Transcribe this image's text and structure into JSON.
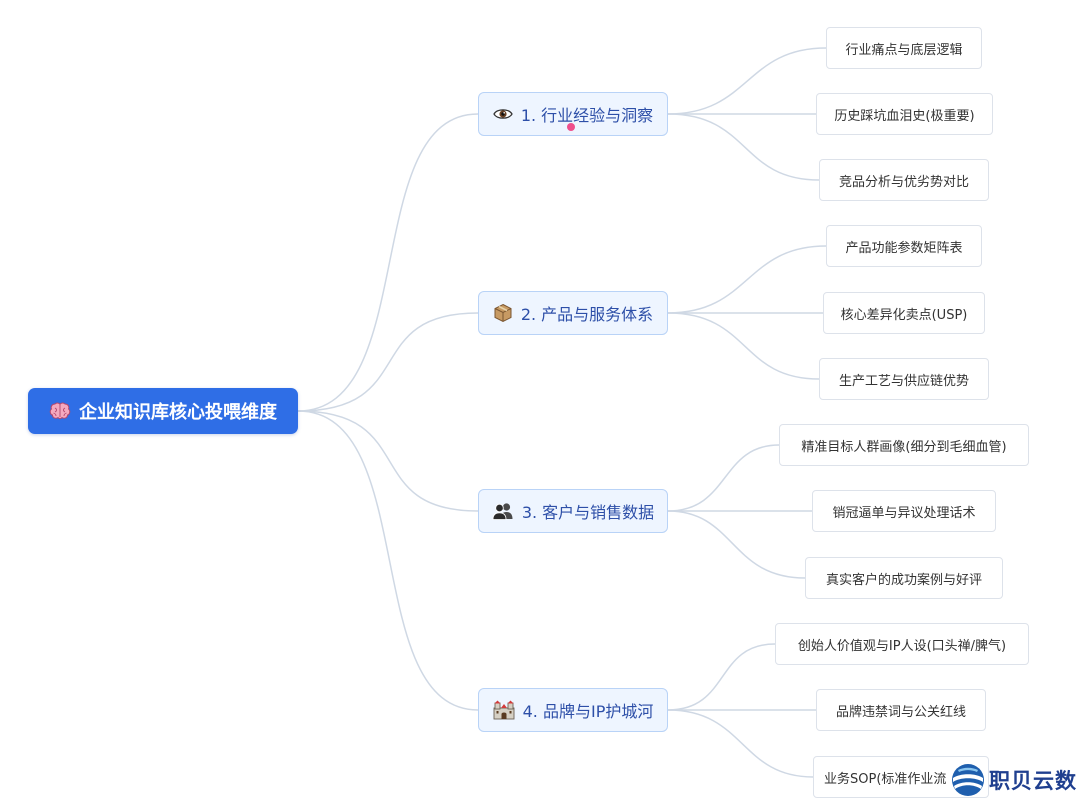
{
  "mindmap": {
    "root": {
      "icon": "brain-icon",
      "label": "企业知识库核心投喂维度"
    },
    "branches": [
      {
        "icon": "eye-icon",
        "label": "1. 行业经验与洞察",
        "children": [
          "行业痛点与底层逻辑",
          "历史踩坑血泪史(极重要)",
          "竞品分析与优劣势对比"
        ]
      },
      {
        "icon": "package-icon",
        "label": "2. 产品与服务体系",
        "children": [
          "产品功能参数矩阵表",
          "核心差异化卖点(USP)",
          "生产工艺与供应链优势"
        ]
      },
      {
        "icon": "users-icon",
        "label": "3. 客户与销售数据",
        "children": [
          "精准目标人群画像(细分到毛细血管)",
          "销冠逼单与异议处理话术",
          "真实客户的成功案例与好评"
        ]
      },
      {
        "icon": "castle-icon",
        "label": "4. 品牌与IP护城河",
        "children": [
          "创始人价值观与IP人设(口头禅/脾气)",
          "品牌违禁词与公关红线",
          "业务SOP(标准作业流"
        ]
      }
    ]
  },
  "watermark": {
    "icon": "globe-logo-icon",
    "text": "职贝云数"
  },
  "colors": {
    "root_bg": "#2f6ee6",
    "branch_bg": "#eef5ff",
    "branch_border": "#b9d3f7",
    "branch_text": "#2d4fa8",
    "edge": "#cfd8e4",
    "cursor_dot": "#ef4f8c"
  }
}
